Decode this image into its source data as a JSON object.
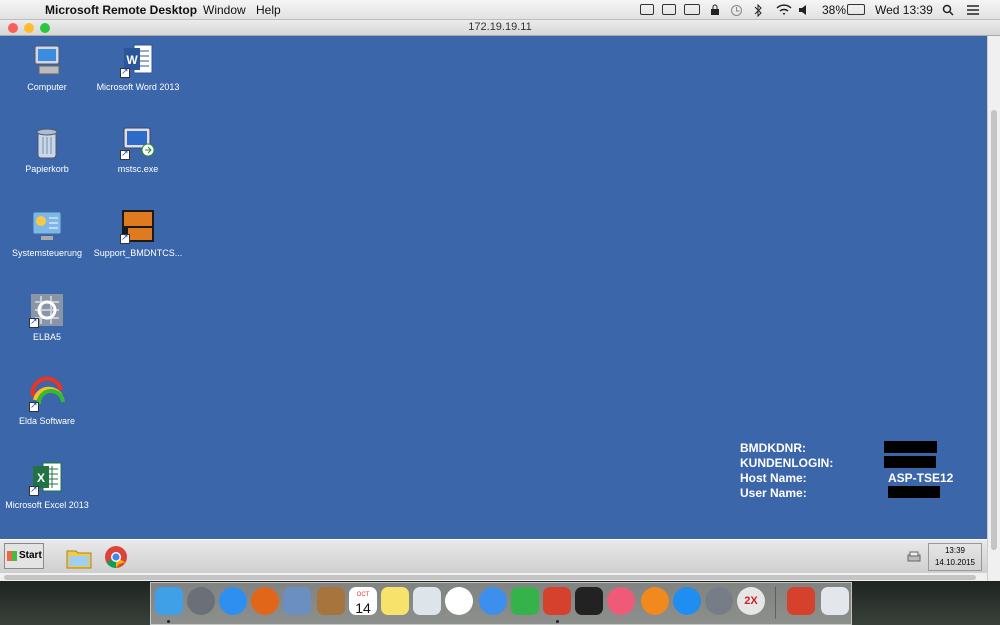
{
  "menubar": {
    "apple": "",
    "app_name": "Microsoft Remote Desktop",
    "menus": [
      "Window",
      "Help"
    ],
    "battery": "38%",
    "clock": "Wed 13:39"
  },
  "window": {
    "title": "172.19.19.11"
  },
  "desktop_icons": [
    {
      "label": "Computer"
    },
    {
      "label": "Microsoft Word 2013"
    },
    {
      "label": "Papierkorb"
    },
    {
      "label": "mstsc.exe"
    },
    {
      "label": "Systemsteuerung"
    },
    {
      "label": "Support_BMDNTCS..."
    },
    {
      "label": "ELBA5"
    },
    {
      "label": "Elda Software"
    },
    {
      "label": "Microsoft Excel 2013"
    }
  ],
  "info": {
    "labels": [
      "BMDKDNR:",
      "KUNDENLOGIN:",
      "Host Name:",
      "User Name:"
    ],
    "host_value": "ASP-TSE12"
  },
  "taskbar": {
    "start_label": "Start",
    "clock_time": "13:39",
    "clock_date": "14.10.2015"
  },
  "colors": {
    "desktop": "#3b66a9",
    "menubar": "#e9e9e9"
  },
  "dock": {
    "calendar_month": "OCT",
    "calendar_day": "14",
    "badge_text": "2X"
  }
}
